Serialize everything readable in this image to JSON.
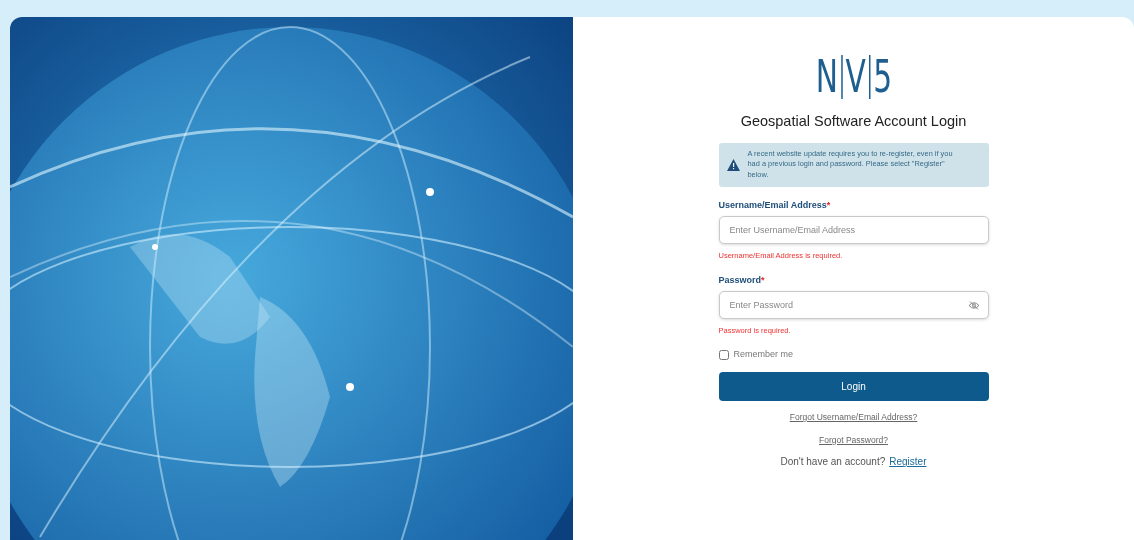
{
  "logo": {
    "letters": [
      "N",
      "V",
      "5"
    ]
  },
  "title": "Geospatial Software Account Login",
  "alert": {
    "text": "A recent website update requires you to re-register, even if you had a previous login and password. Please select \"Register\" below."
  },
  "fields": [
    {
      "kind": "text",
      "label": "Username/Email Address",
      "required_mark": "*",
      "placeholder": "Enter Username/Email Address",
      "error": "Username/Email Address is required."
    },
    {
      "kind": "password",
      "label": "Password",
      "required_mark": "*",
      "placeholder": "Enter Password",
      "error": "Password is required."
    }
  ],
  "remember": {
    "label": "Remember me",
    "checked": false
  },
  "login_button": "Login",
  "links": [
    "Forgot Username/Email Address?",
    "Forgot Password?"
  ],
  "signup": {
    "text": "Don't have an account?",
    "link": "Register"
  }
}
